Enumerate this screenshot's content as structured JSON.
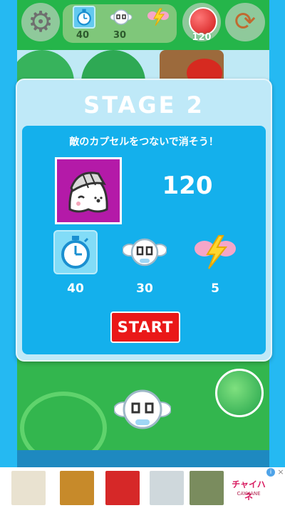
{
  "topbar": {
    "counters": [
      {
        "icon": "stopwatch-icon",
        "value": "40"
      },
      {
        "icon": "ghost-capsule-icon",
        "value": "30"
      },
      {
        "icon": "winged-lightning-icon",
        "value": ""
      }
    ],
    "capsule_value": "120",
    "gear_icon": "gear-icon",
    "reload_icon": "reload-icon"
  },
  "dialog": {
    "title": "STAGE 2",
    "mission": "敵のカプセルをつないで消そう！",
    "enemy_count": "120",
    "stats": [
      {
        "icon": "stopwatch-icon",
        "value": "40",
        "selected": true
      },
      {
        "icon": "ghost-capsule-icon",
        "value": "30",
        "selected": false
      },
      {
        "icon": "winged-lightning-icon",
        "value": "5",
        "selected": false
      }
    ],
    "start_label": "START"
  },
  "ad": {
    "logo": "チャイハネ",
    "logo_sub": "CAYHANE",
    "info_glyph": "i",
    "close_glyph": "×"
  },
  "colors": {
    "field_green": "#25b54a",
    "dialog_blue": "#14b0ec",
    "start_red": "#ea1818",
    "enemy_purple": "#b41aa8"
  }
}
